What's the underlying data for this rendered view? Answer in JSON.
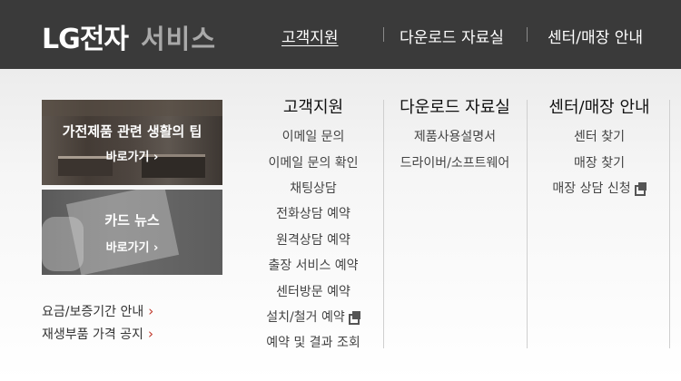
{
  "header": {
    "brand": "LG전자",
    "sub": "서비스",
    "nav": [
      {
        "label": "고객지원",
        "active": true
      },
      {
        "label": "다운로드 자료실",
        "active": false
      },
      {
        "label": "센터/매장 안내",
        "active": false
      }
    ]
  },
  "promos": [
    {
      "title": "가전제품 관련 생활의 팁",
      "link": "바로가기 ›"
    },
    {
      "title": "카드 뉴스",
      "link": "바로가기 ›"
    }
  ],
  "side_links": [
    {
      "label": "요금/보증기간 안내",
      "icon": "chevron-right-icon"
    },
    {
      "label": "재생부품 가격 공지",
      "icon": "chevron-right-icon"
    }
  ],
  "columns": [
    {
      "heading": "고객지원",
      "items": [
        {
          "label": "이메일 문의"
        },
        {
          "label": "이메일 문의 확인"
        },
        {
          "label": "채팅상담"
        },
        {
          "label": "전화상담 예약"
        },
        {
          "label": "원격상담 예약"
        },
        {
          "label": "출장 서비스 예약"
        },
        {
          "label": "센터방문 예약"
        },
        {
          "label": "설치/철거 예약",
          "icon": "external-window-icon"
        },
        {
          "label": "예약 및 결과 조회"
        }
      ]
    },
    {
      "heading": "다운로드 자료실",
      "items": [
        {
          "label": "제품사용설명서"
        },
        {
          "label": "드라이버/소프트웨어"
        }
      ]
    },
    {
      "heading": "센터/매장 안내",
      "items": [
        {
          "label": "센터 찾기"
        },
        {
          "label": "매장 찾기"
        },
        {
          "label": "매장 상담 신청",
          "icon": "external-window-icon"
        }
      ]
    }
  ],
  "colors": {
    "header_bg": "#3a3a3a",
    "accent_chevron": "#c0392b"
  }
}
